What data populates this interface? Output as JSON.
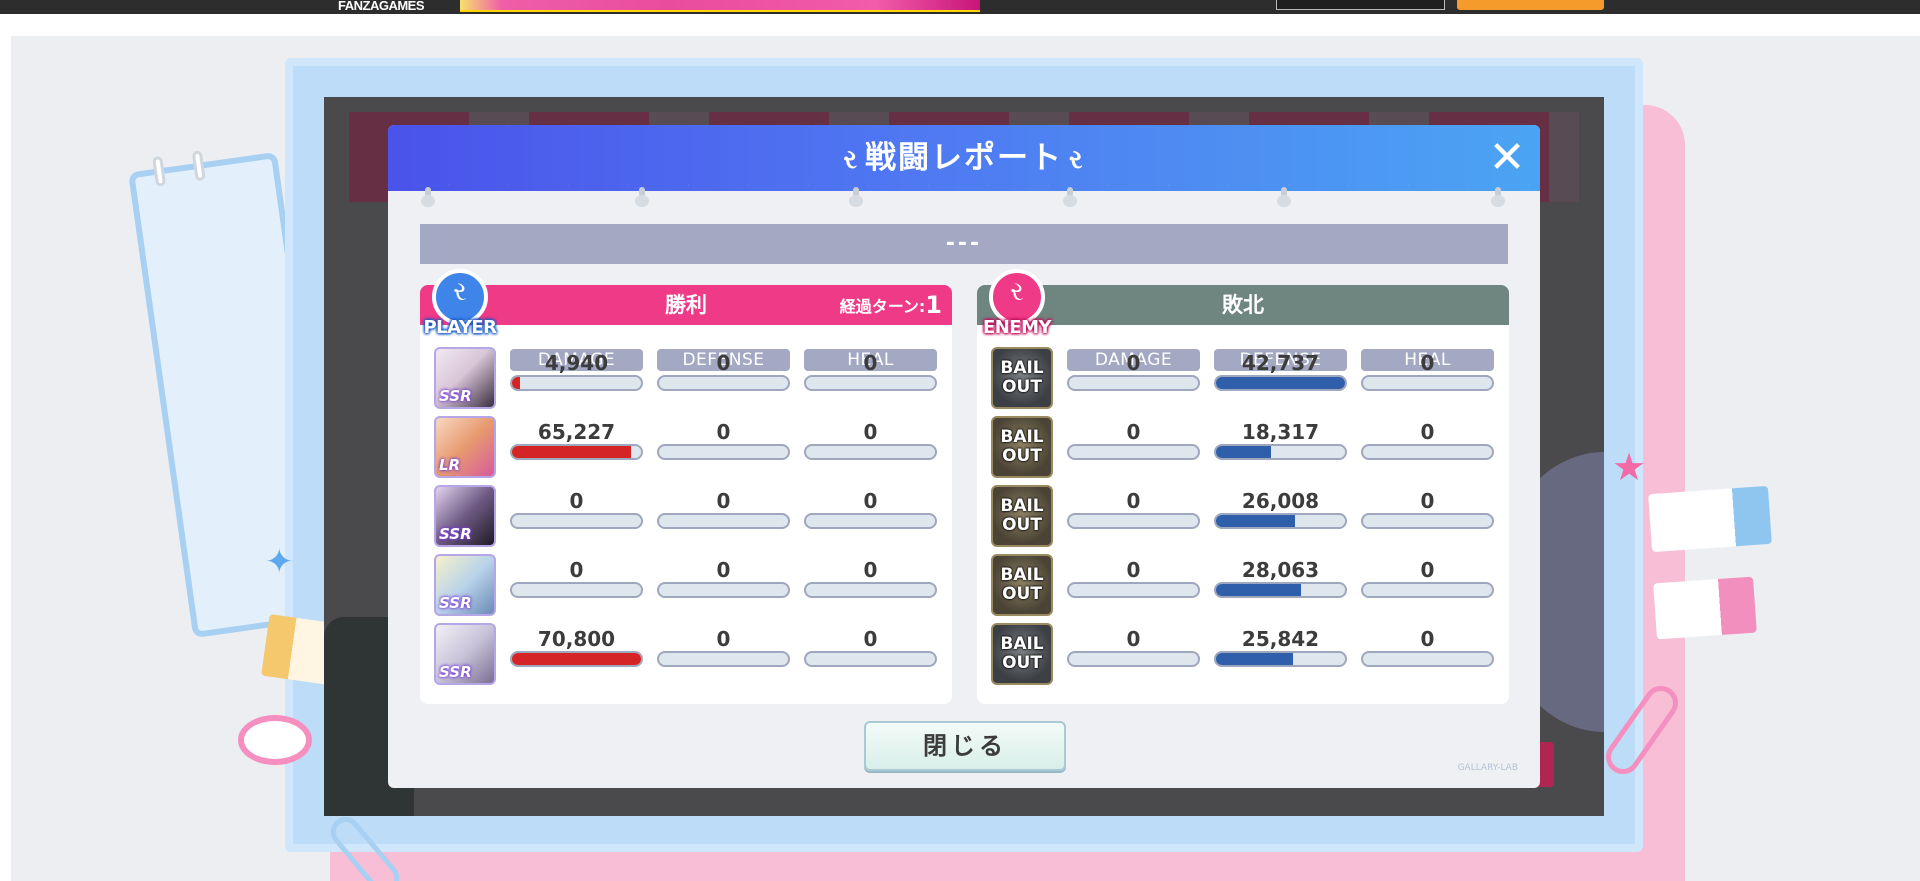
{
  "topbar": {
    "logo": "FANZAGAMES"
  },
  "dialog": {
    "title": "戦闘レポート",
    "title_wing_left": "ર",
    "title_wing_right": "ર",
    "close_icon": "✕",
    "result_text": "---",
    "close_button": "閉じる",
    "watermark": "GALLARY-LAB"
  },
  "player": {
    "badge": "PLAYER",
    "result": "勝利",
    "turn_label": "経過ターン:",
    "turn_value": "1",
    "columns": [
      "DAMAGE",
      "DEFENSE",
      "HEAL"
    ],
    "rows": [
      {
        "rank": "SSR",
        "damage": "4,940",
        "defense": "0",
        "heal": "0",
        "damage_fill": 0.06,
        "defense_fill": 0,
        "heal_fill": 0
      },
      {
        "rank": "LR",
        "damage": "65,227",
        "defense": "0",
        "heal": "0",
        "damage_fill": 0.92,
        "defense_fill": 0,
        "heal_fill": 0
      },
      {
        "rank": "SSR",
        "damage": "0",
        "defense": "0",
        "heal": "0",
        "damage_fill": 0,
        "defense_fill": 0,
        "heal_fill": 0
      },
      {
        "rank": "SSR",
        "damage": "0",
        "defense": "0",
        "heal": "0",
        "damage_fill": 0,
        "defense_fill": 0,
        "heal_fill": 0
      },
      {
        "rank": "SSR",
        "damage": "70,800",
        "defense": "0",
        "heal": "0",
        "damage_fill": 1.0,
        "defense_fill": 0,
        "heal_fill": 0
      }
    ]
  },
  "enemy": {
    "badge": "ENEMY",
    "result": "敗北",
    "columns": [
      "DAMAGE",
      "DEFENSE",
      "HEAL"
    ],
    "rows": [
      {
        "status": "BAIL OUT",
        "damage": "0",
        "defense": "42,737",
        "heal": "0",
        "damage_fill": 0,
        "defense_fill": 1.0,
        "heal_fill": 0
      },
      {
        "status": "BAIL OUT",
        "damage": "0",
        "defense": "18,317",
        "heal": "0",
        "damage_fill": 0,
        "defense_fill": 0.43,
        "heal_fill": 0
      },
      {
        "status": "BAIL OUT",
        "damage": "0",
        "defense": "26,008",
        "heal": "0",
        "damage_fill": 0,
        "defense_fill": 0.61,
        "heal_fill": 0
      },
      {
        "status": "BAIL OUT",
        "damage": "0",
        "defense": "28,063",
        "heal": "0",
        "damage_fill": 0,
        "defense_fill": 0.66,
        "heal_fill": 0
      },
      {
        "status": "BAIL OUT",
        "damage": "0",
        "defense": "25,842",
        "heal": "0",
        "damage_fill": 0,
        "defense_fill": 0.6,
        "heal_fill": 0
      }
    ]
  },
  "colors": {
    "damage_bar": "#d52426",
    "defense_bar": "#2f5eaa",
    "player_header": "#ee3a87",
    "enemy_header": "#6e8580",
    "title_bar": "#4f78f2"
  }
}
